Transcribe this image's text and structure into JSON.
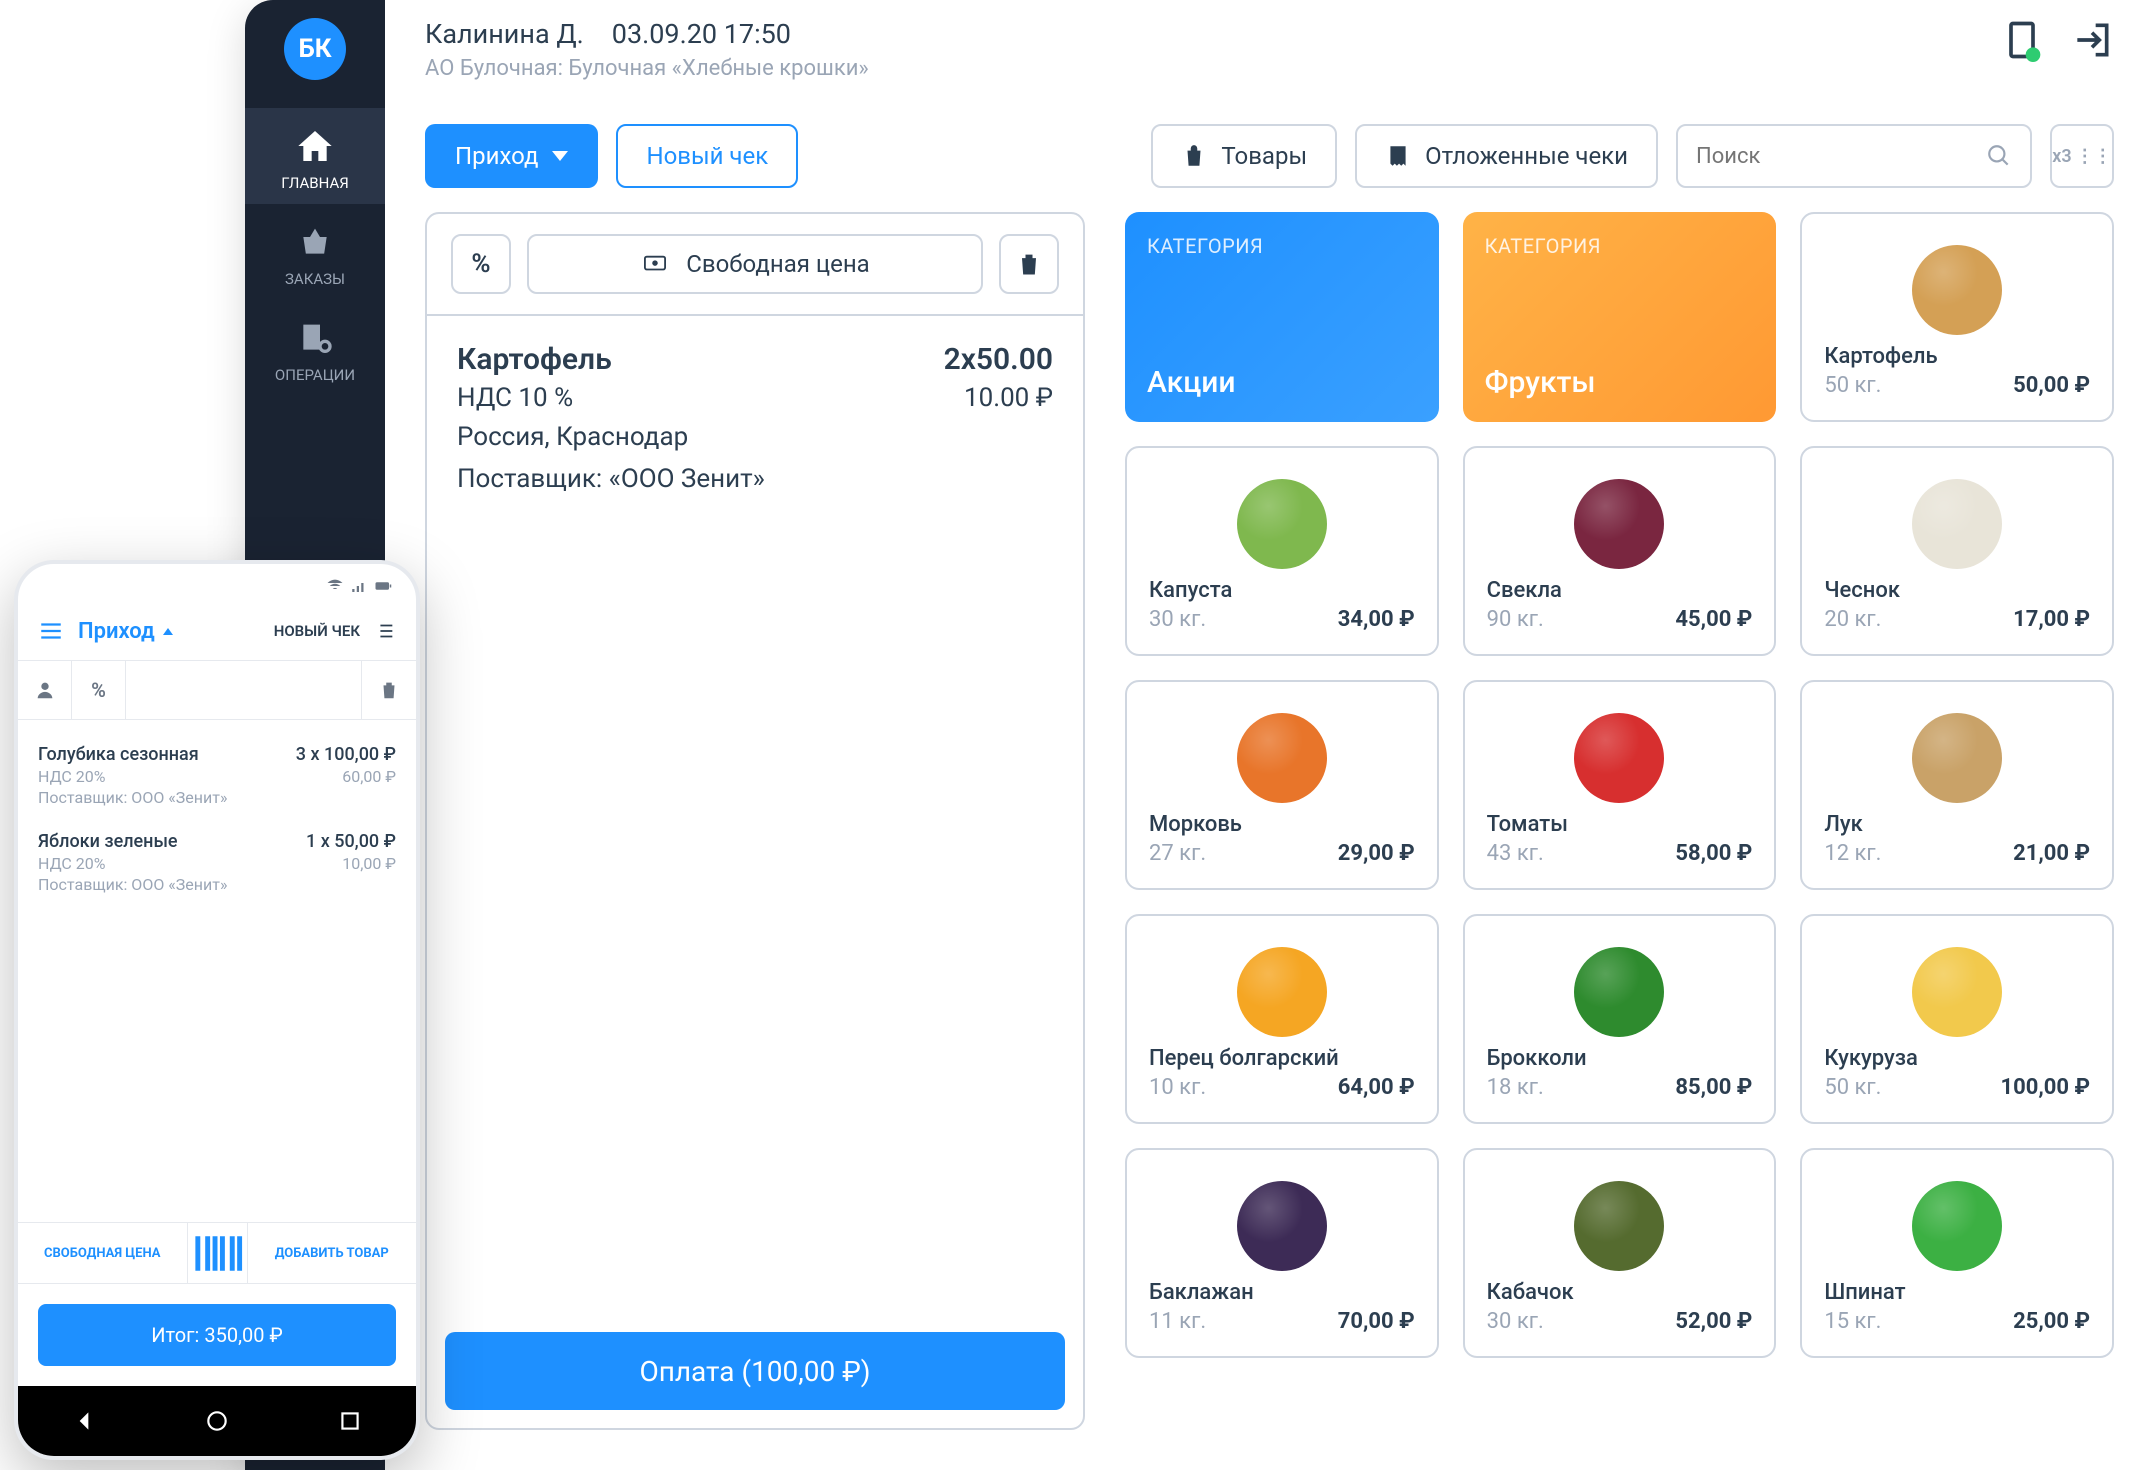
{
  "tablet": {
    "logo": "БК",
    "nav": [
      {
        "label": "ГЛАВНАЯ"
      },
      {
        "label": "ЗАКАЗЫ"
      },
      {
        "label": "ОПЕРАЦИИ"
      }
    ],
    "topbar": {
      "user": "Калинина Д.",
      "datetime": "03.09.20 17:50",
      "org": "АО Булочная: Булочная «Хлебные крошки»"
    },
    "actions": {
      "income": "Приход",
      "new_receipt": "Новый чек",
      "products": "Товары",
      "deferred": "Отложенные чеки",
      "search_placeholder": "Поиск",
      "grid": "x3"
    },
    "receipt": {
      "percent_label": "%",
      "free_price": "Свободная цена",
      "item_name": "Картофель",
      "item_qty_price": "2x50.00",
      "vat_label": "НДС 10 %",
      "vat_value": "10.00 ₽",
      "origin": "Россия, Краснодар",
      "supplier": "Поставщик: «ООО Зенит»",
      "pay": "Оплата (100,00 ₽)"
    },
    "categories": {
      "label": "КАТЕГОРИЯ",
      "promo": "Акции",
      "fruits": "Фрукты"
    },
    "products": [
      {
        "name": "Картофель",
        "weight": "50 кг.",
        "price": "50,00 ₽",
        "color": "#d4a055"
      },
      {
        "name": "Капуста",
        "weight": "30 кг.",
        "price": "34,00 ₽",
        "color": "#7fb84e"
      },
      {
        "name": "Свекла",
        "weight": "90 кг.",
        "price": "45,00 ₽",
        "color": "#7a2640"
      },
      {
        "name": "Чеснок",
        "weight": "20 кг.",
        "price": "17,00 ₽",
        "color": "#e8e4d8"
      },
      {
        "name": "Морковь",
        "weight": "27 кг.",
        "price": "29,00 ₽",
        "color": "#e8752a"
      },
      {
        "name": "Томаты",
        "weight": "43 кг.",
        "price": "58,00 ₽",
        "color": "#d72f2f"
      },
      {
        "name": "Лук",
        "weight": "12 кг.",
        "price": "21,00 ₽",
        "color": "#c9a268"
      },
      {
        "name": "Перец болгарский",
        "weight": "10 кг.",
        "price": "64,00 ₽",
        "color": "#f5a623"
      },
      {
        "name": "Брокколи",
        "weight": "18 кг.",
        "price": "85,00 ₽",
        "color": "#2e8b2e"
      },
      {
        "name": "Кукуруза",
        "weight": "50 кг.",
        "price": "100,00 ₽",
        "color": "#f2c94c"
      },
      {
        "name": "Баклажан",
        "weight": "11 кг.",
        "price": "70,00 ₽",
        "color": "#3d2b56"
      },
      {
        "name": "Кабачок",
        "weight": "30 кг.",
        "price": "52,00 ₽",
        "color": "#556b2f"
      },
      {
        "name": "Шпинат",
        "weight": "15 кг.",
        "price": "25,00 ₽",
        "color": "#3cb043"
      }
    ]
  },
  "phone": {
    "header": {
      "title": "Приход",
      "new": "НОВЫЙ ЧЕК"
    },
    "items": [
      {
        "name": "Голубика сезонная",
        "qty": "3 х 100,00 ₽",
        "vat": "НДС 20%",
        "vat_val": "60,00 ₽",
        "supplier": "Поставщик: ООО «Зенит»"
      },
      {
        "name": "Яблоки зеленые",
        "qty": "1 х 50,00 ₽",
        "vat": "НДС 20%",
        "vat_val": "10,00 ₽",
        "supplier": "Поставщик: ООО «Зенит»"
      }
    ],
    "actions": {
      "free": "СВОБОДНАЯ ЦЕНА",
      "add": "ДОБАВИТЬ ТОВАР"
    },
    "total": "Итог: 350,00 ₽"
  }
}
